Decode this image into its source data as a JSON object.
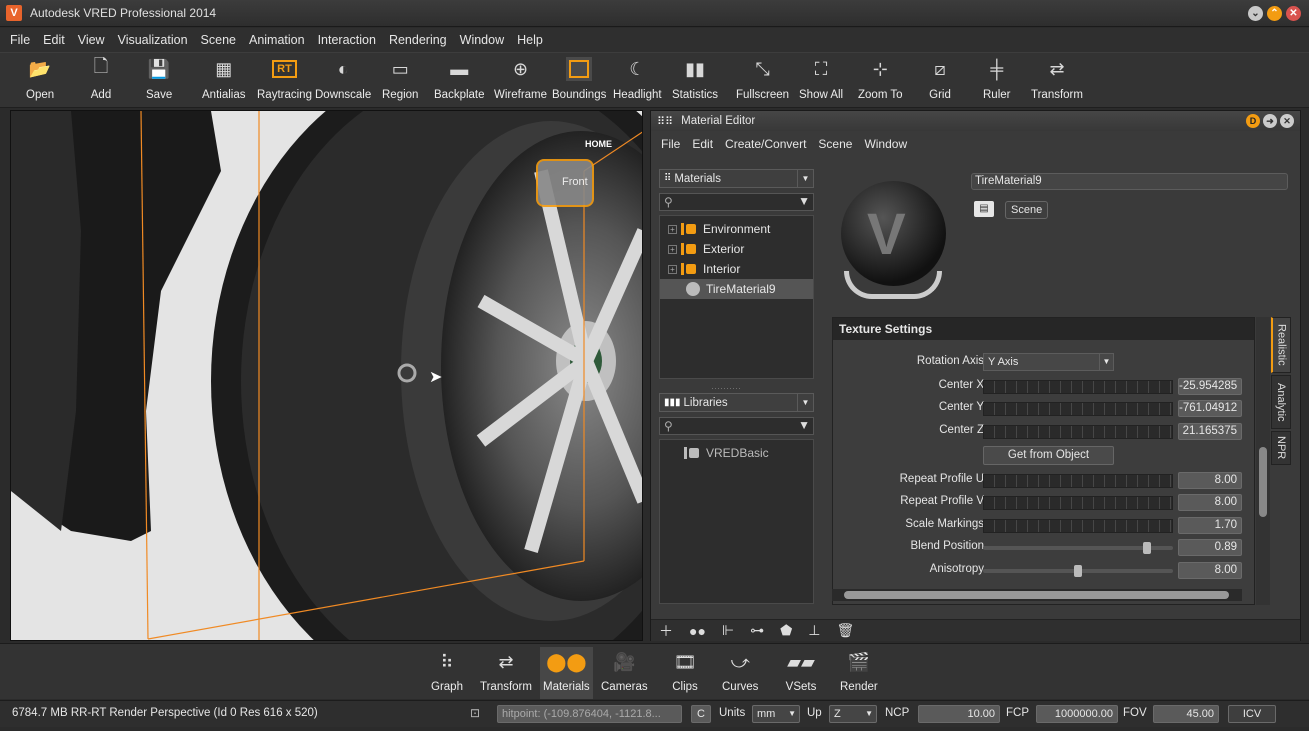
{
  "window": {
    "title": "Autodesk VRED Professional 2014",
    "logo": "V"
  },
  "menubar": [
    "File",
    "Edit",
    "View",
    "Visualization",
    "Scene",
    "Animation",
    "Interaction",
    "Rendering",
    "Window",
    "Help"
  ],
  "toolbar": {
    "open": "Open",
    "add": "Add",
    "save": "Save",
    "antialias": "Antialias",
    "raytracing": "Raytracing",
    "raytracing_badge": "RT",
    "downscale": "Downscale",
    "region": "Region",
    "backplate": "Backplate",
    "wireframe": "Wireframe",
    "boundings": "Boundings",
    "headlight": "Headlight",
    "statistics": "Statistics",
    "fullscreen": "Fullscreen",
    "show_all": "Show All",
    "zoom_to": "Zoom To",
    "grid": "Grid",
    "ruler": "Ruler",
    "transform": "Transform"
  },
  "viewport": {
    "navcube_top": "HOME",
    "navcube_face": "Front"
  },
  "material_editor": {
    "title": "Material Editor",
    "title_badge": "D",
    "menu": [
      "File",
      "Edit",
      "Create/Convert",
      "Scene",
      "Window"
    ],
    "materials_combo": "Materials",
    "materials_tree": [
      {
        "label": "Environment",
        "type": "group"
      },
      {
        "label": "Exterior",
        "type": "group"
      },
      {
        "label": "Interior",
        "type": "group"
      },
      {
        "label": "TireMaterial9",
        "type": "material",
        "selected": true
      }
    ],
    "libraries_combo": "Libraries",
    "libraries_tree": [
      {
        "label": "VREDBasic"
      }
    ],
    "material_name": "TireMaterial9",
    "scene_button": "Scene",
    "texture_settings": {
      "header": "Texture Settings",
      "rotation_axis_label": "Rotation Axis",
      "rotation_axis_value": "Y Axis",
      "center_x_label": "Center X",
      "center_x": "-25.954285",
      "center_y_label": "Center Y",
      "center_y": "-761.04912",
      "center_z_label": "Center Z",
      "center_z": "21.165375",
      "get_from_object": "Get from Object",
      "repeat_u_label": "Repeat Profile U",
      "repeat_u": "8.00",
      "repeat_v_label": "Repeat Profile V",
      "repeat_v": "8.00",
      "scale_markings_label": "Scale Markings",
      "scale_markings": "1.70",
      "blend_position_label": "Blend Position",
      "blend_position": "0.89",
      "anisotropy_label": "Anisotropy",
      "anisotropy": "8.00"
    },
    "side_tabs": [
      "Realistic",
      "Analytic",
      "NPR"
    ]
  },
  "modules": [
    "Graph",
    "Transform",
    "Materials",
    "Cameras",
    "Clips",
    "Curves",
    "VSets",
    "Render"
  ],
  "status": {
    "info": "6784.7 MB  RR-RT  Render Perspective (Id 0 Res 616 x 520)",
    "hitpoint": "hitpoint: (-109.876404, -1121.8...",
    "c_button": "C",
    "units_label": "Units",
    "units_value": "mm",
    "up_label": "Up",
    "up_value": "Z",
    "ncp_label": "NCP",
    "ncp_value": "10.00",
    "fcp_label": "FCP",
    "fcp_value": "1000000.00",
    "fov_label": "FOV",
    "fov_value": "45.00",
    "icv": "ICV"
  }
}
